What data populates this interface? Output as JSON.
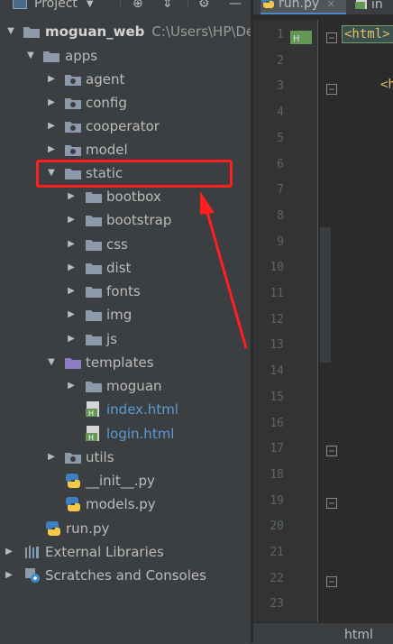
{
  "project_panel": {
    "title": "Project",
    "root": {
      "name": "moguan_web",
      "path": "C:\\Users\\HP\\Des"
    },
    "apps": "apps",
    "agent": "agent",
    "config": "config",
    "cooperator": "cooperator",
    "model": "model",
    "static": "static",
    "bootbox": "bootbox",
    "bootstrap": "bootstrap",
    "css": "css",
    "dist": "dist",
    "fonts": "fonts",
    "img": "img",
    "js": "js",
    "templates": "templates",
    "moguan": "moguan",
    "index_html": "index.html",
    "login_html": "login.html",
    "utils": "utils",
    "init_py": "__init__.py",
    "models_py": "models.py",
    "run_py": "run.py",
    "external_libraries": "External Libraries",
    "scratches": "Scratches and Consoles"
  },
  "editor": {
    "active_tab": "run.py",
    "second_tab": "in",
    "line_numbers": [
      "1",
      "2",
      "3",
      "4",
      "5",
      "6",
      "7",
      "8",
      "9",
      "10",
      "11",
      "12",
      "13",
      "14",
      "15",
      "16",
      "17",
      "18",
      "19",
      "20",
      "21",
      "22",
      "23"
    ],
    "code_line1": "<html>",
    "code_line3": "<h",
    "status": "html"
  },
  "colors": {
    "selection_highlight": "#ff1f1f",
    "folder": "#8c9aab",
    "html_link": "#5a9bd5"
  }
}
